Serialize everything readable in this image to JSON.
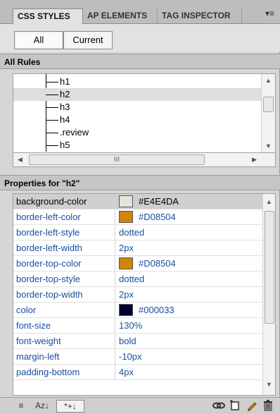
{
  "tabs": [
    {
      "label": "CSS STYLES",
      "active": true
    },
    {
      "label": "AP ELEMENTS",
      "active": false
    },
    {
      "label": "TAG INSPECTOR",
      "active": false
    }
  ],
  "tab_menu_icon": "▾≡",
  "toggle": {
    "all": "All",
    "current": "Current"
  },
  "all_rules_header": "All Rules",
  "rules": [
    {
      "label": "h1",
      "selected": false
    },
    {
      "label": "h2",
      "selected": true
    },
    {
      "label": "h3",
      "selected": false
    },
    {
      "label": "h4",
      "selected": false
    },
    {
      "label": ".review",
      "selected": false
    },
    {
      "label": "h5",
      "selected": false
    }
  ],
  "hscroll_thumb": "III",
  "properties_header": "Properties for \"h2\"",
  "properties": [
    {
      "name": "background-color",
      "value": "#E4E4DA",
      "swatch": "#E4E4DA",
      "selected": true
    },
    {
      "name": "border-left-color",
      "value": "#D08504",
      "swatch": "#D08504",
      "selected": false
    },
    {
      "name": "border-left-style",
      "value": "dotted",
      "swatch": null,
      "selected": false
    },
    {
      "name": "border-left-width",
      "value": "2px",
      "swatch": null,
      "selected": false
    },
    {
      "name": "border-top-color",
      "value": "#D08504",
      "swatch": "#D08504",
      "selected": false
    },
    {
      "name": "border-top-style",
      "value": "dotted",
      "swatch": null,
      "selected": false
    },
    {
      "name": "border-top-width",
      "value": "2px",
      "swatch": null,
      "selected": false
    },
    {
      "name": "color",
      "value": "#000033",
      "swatch": "#000033",
      "selected": false
    },
    {
      "name": "font-size",
      "value": "130%",
      "swatch": null,
      "selected": false
    },
    {
      "name": "font-weight",
      "value": "bold",
      "swatch": null,
      "selected": false
    },
    {
      "name": "margin-left",
      "value": "-10px",
      "swatch": null,
      "selected": false
    },
    {
      "name": "padding-bottom",
      "value": "4px",
      "swatch": null,
      "selected": false
    }
  ],
  "bottom_toolbar": {
    "left_buttons": [
      {
        "icon": "category-view-icon",
        "label": "≡"
      },
      {
        "icon": "sort-az-icon",
        "label": "Az↓"
      },
      {
        "icon": "show-set-properties-icon",
        "label": "*+↓"
      }
    ],
    "right_buttons": [
      {
        "icon": "attach-stylesheet-icon"
      },
      {
        "icon": "new-css-rule-icon"
      },
      {
        "icon": "edit-style-icon"
      },
      {
        "icon": "delete-css-rule-icon"
      }
    ]
  }
}
